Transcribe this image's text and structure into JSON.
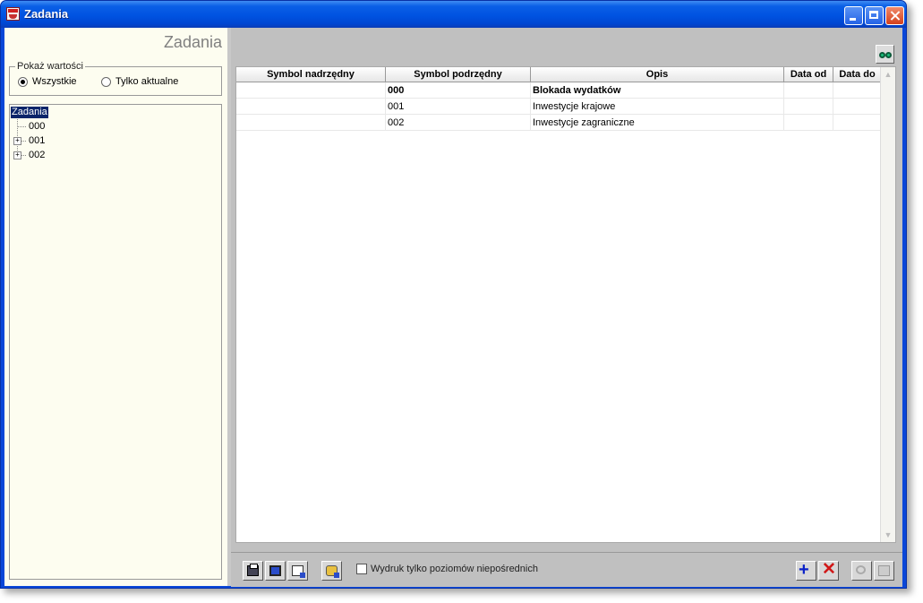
{
  "window": {
    "title": "Zadania"
  },
  "left": {
    "title": "Zadania",
    "group_label": "Pokaż wartości",
    "radio_all": "Wszystkie",
    "radio_current": "Tylko aktualne",
    "tree": {
      "root": "Zadania",
      "items": [
        "000",
        "001",
        "002"
      ]
    }
  },
  "grid": {
    "columns": [
      "Symbol nadrzędny",
      "Symbol podrzędny",
      "Opis",
      "Data od",
      "Data do"
    ],
    "rows": [
      [
        "",
        "000",
        "Blokada wydatków",
        "",
        ""
      ],
      [
        "",
        "001",
        "Inwestycje krajowe",
        "",
        ""
      ],
      [
        "",
        "002",
        "Inwestycje zagraniczne",
        "",
        ""
      ]
    ]
  },
  "toolbar": {
    "checkbox_label": "Wydruk tylko poziomów niepośrednich"
  },
  "icons": [
    "app-icon",
    "minimize-icon",
    "maximize-icon",
    "close-icon",
    "binoculars-icon",
    "print-icon",
    "screen-preview-icon",
    "export-icon",
    "database-icon",
    "plus-icon",
    "delete-icon",
    "undo-icon",
    "save-icon"
  ],
  "colors": {
    "titlebar": "#0053e1",
    "tree_selection": "#0a246a",
    "panel": "#fdfdf0",
    "client": "#c0c0c0"
  }
}
